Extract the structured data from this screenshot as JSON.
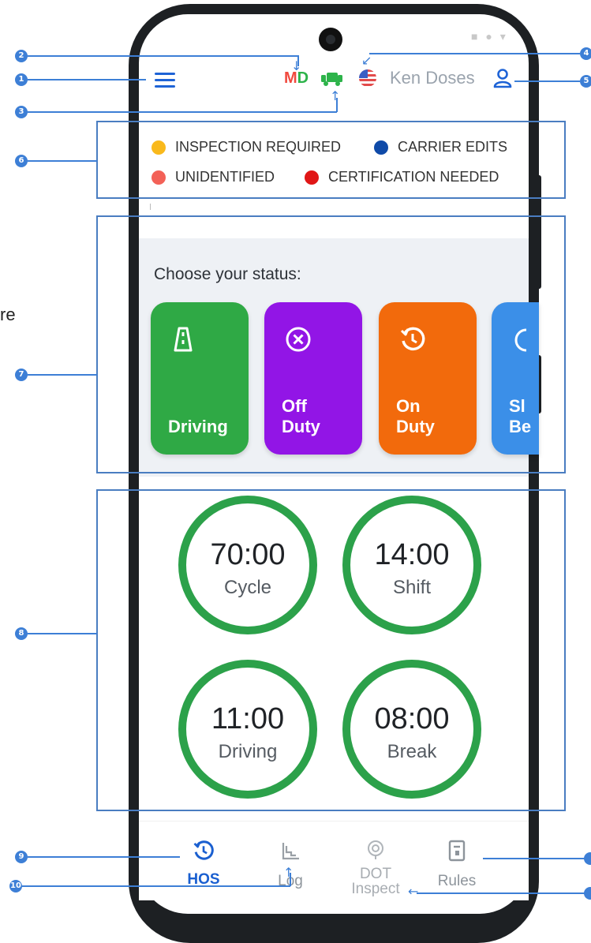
{
  "header": {
    "state_code_a": "M",
    "state_code_b": "D",
    "user_name": "Ken Doses"
  },
  "legend": [
    {
      "label": "INSPECTION REQUIRED",
      "color": "#f9b91c"
    },
    {
      "label": "CARRIER EDITS",
      "color": "#0f4aa8"
    },
    {
      "label": "UNIDENTIFIED",
      "color": "#f36157"
    },
    {
      "label": "CERTIFICATION NEEDED",
      "color": "#e01616"
    }
  ],
  "status": {
    "title": "Choose your status:",
    "cards": [
      {
        "label": "Driving",
        "color": "#2fa945",
        "icon": "road-icon"
      },
      {
        "label": "Off\nDuty",
        "color": "#9215e6",
        "icon": "close-circle-icon"
      },
      {
        "label": "On\nDuty",
        "color": "#f26a0c",
        "icon": "clock-history-icon"
      },
      {
        "label": "Sl\nBe",
        "color": "#3b8fe8",
        "icon": "sleeper-icon"
      }
    ]
  },
  "timers": [
    {
      "value": "70:00",
      "label": "Cycle"
    },
    {
      "value": "14:00",
      "label": "Shift"
    },
    {
      "value": "11:00",
      "label": "Driving"
    },
    {
      "value": "08:00",
      "label": "Break"
    }
  ],
  "nav": {
    "hos": "HOS",
    "log": "Log",
    "dot_line1": "DOT",
    "dot_line2": "Inspect",
    "rules": "Rules",
    "active_color": "#1a5fd0",
    "inactive_color": "#8d949b"
  },
  "annotations": {
    "n1": "1",
    "n2": "2",
    "n3": "3",
    "n4": "4",
    "n5": "5",
    "n6": "6",
    "n7": "7",
    "n8": "8",
    "n9": "9",
    "n10": "10",
    "edge_text": "re"
  }
}
